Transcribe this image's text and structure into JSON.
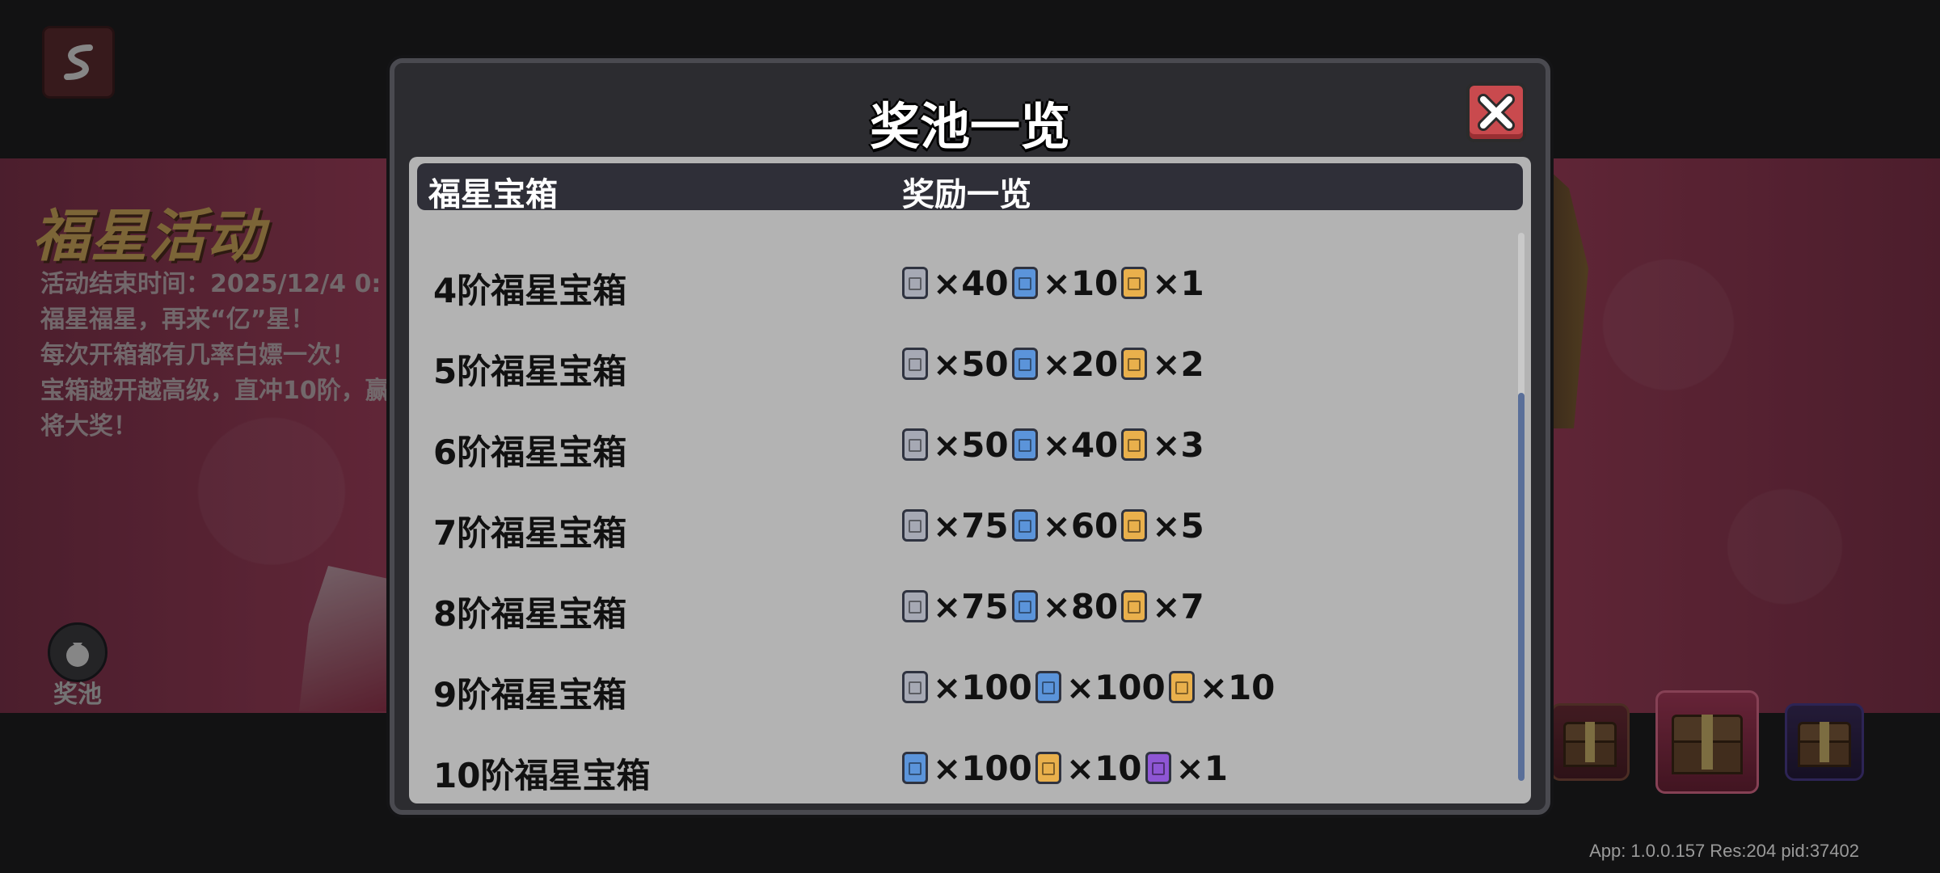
{
  "background": {
    "event_title": "福星活动",
    "event_desc": [
      "活动结束时间：2025/12/4 0:",
      "福星福星，再来“亿”星！",
      "每次开箱都有几率白嫖一次！",
      "宝箱越开越高级，直冲10阶，赢",
      "将大奖！"
    ],
    "pool_button_label": "奖池",
    "version_text": "App: 1.0.0.157 Res:204 pid:37402"
  },
  "modal": {
    "title": "奖池一览",
    "header_col1": "福星宝箱",
    "header_col2": "奖励一览",
    "rows": [
      {
        "name": "4阶福星宝箱",
        "rewards": [
          {
            "icon": "gray-gem-icon",
            "qty": "×40"
          },
          {
            "icon": "blue-gem-icon",
            "qty": "×10"
          },
          {
            "icon": "gold-gem-icon",
            "qty": "×1"
          }
        ]
      },
      {
        "name": "5阶福星宝箱",
        "rewards": [
          {
            "icon": "gray-gem-icon",
            "qty": "×50"
          },
          {
            "icon": "blue-gem-icon",
            "qty": "×20"
          },
          {
            "icon": "gold-gem-icon",
            "qty": "×2"
          }
        ]
      },
      {
        "name": "6阶福星宝箱",
        "rewards": [
          {
            "icon": "gray-gem-icon",
            "qty": "×50"
          },
          {
            "icon": "blue-gem-icon",
            "qty": "×40"
          },
          {
            "icon": "gold-gem-icon",
            "qty": "×3"
          }
        ]
      },
      {
        "name": "7阶福星宝箱",
        "rewards": [
          {
            "icon": "gray-gem-icon",
            "qty": "×75"
          },
          {
            "icon": "blue-gem-icon",
            "qty": "×60"
          },
          {
            "icon": "gold-gem-icon",
            "qty": "×5"
          }
        ]
      },
      {
        "name": "8阶福星宝箱",
        "rewards": [
          {
            "icon": "gray-gem-icon",
            "qty": "×75"
          },
          {
            "icon": "blue-gem-icon",
            "qty": "×80"
          },
          {
            "icon": "gold-gem-icon",
            "qty": "×7"
          }
        ]
      },
      {
        "name": "9阶福星宝箱",
        "rewards": [
          {
            "icon": "gray-gem-icon",
            "qty": "×100"
          },
          {
            "icon": "blue-gem-icon",
            "qty": "×100"
          },
          {
            "icon": "gold-gem-icon",
            "qty": "×10"
          }
        ]
      },
      {
        "name": "10阶福星宝箱",
        "rewards": [
          {
            "icon": "blue-gem-icon",
            "qty": "×100"
          },
          {
            "icon": "gold-gem-icon",
            "qty": "×10"
          },
          {
            "icon": "purple-gem-icon",
            "qty": "×1"
          }
        ]
      }
    ]
  },
  "colors": {
    "gray_gem": "#a6a9b4",
    "blue_gem": "#5b94da",
    "gold_gem": "#e9b04c",
    "purple_gem": "#8e56d4",
    "close_button": "#c94a4e",
    "panel": "#b3b3b3"
  }
}
